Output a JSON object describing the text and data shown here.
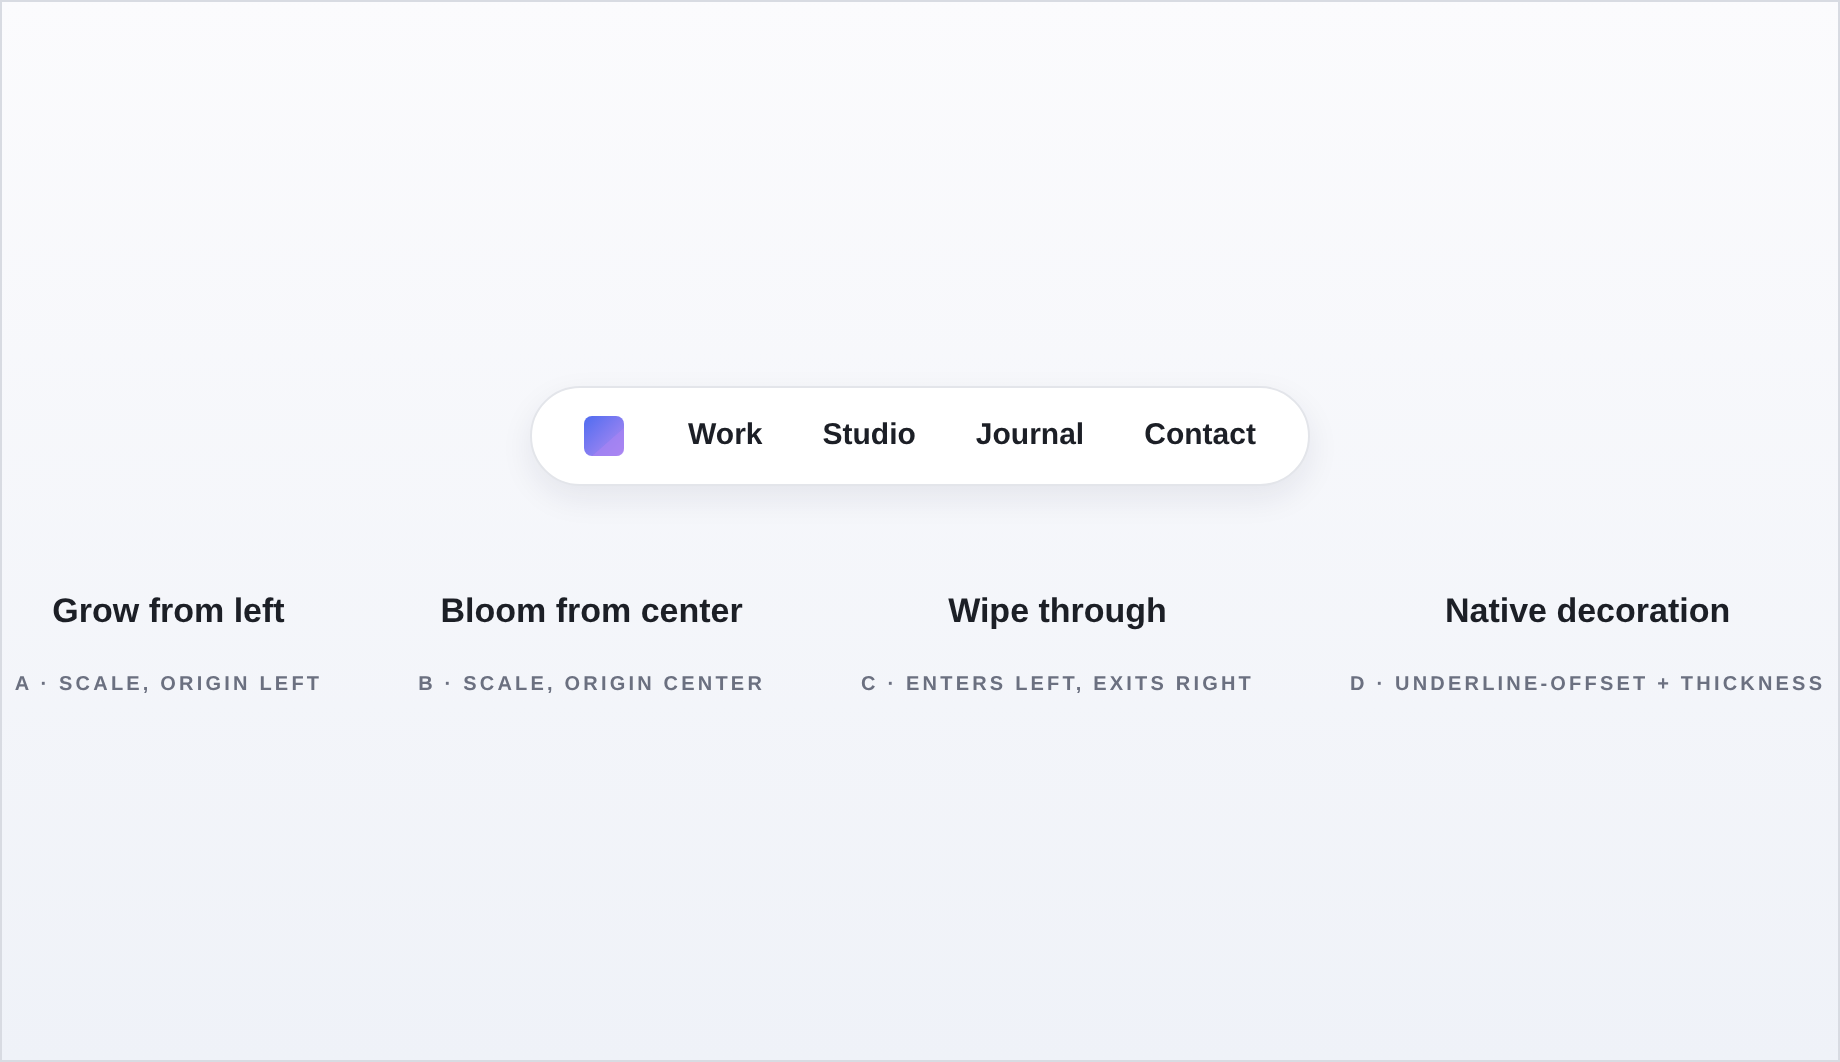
{
  "nav": {
    "links": [
      {
        "label": "Work"
      },
      {
        "label": "Studio"
      },
      {
        "label": "Journal"
      },
      {
        "label": "Contact"
      }
    ]
  },
  "demos": [
    {
      "title": "Grow from left",
      "caption": "A · SCALE, ORIGIN LEFT"
    },
    {
      "title": "Bloom from center",
      "caption": "B · SCALE, ORIGIN CENTER"
    },
    {
      "title": "Wipe through",
      "caption": "C · ENTERS LEFT, EXITS RIGHT"
    },
    {
      "title": "Native decoration",
      "caption": "D · UNDERLINE-OFFSET + THICKNESS"
    }
  ]
}
